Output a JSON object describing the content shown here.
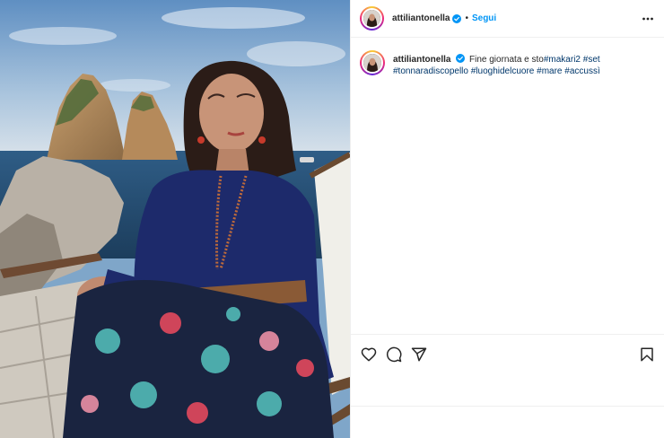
{
  "post": {
    "username": "attiliantonella",
    "follow_label": "Segui",
    "separator": "•",
    "caption": {
      "username": "attiliantonella",
      "text_before": "Fine giornata e sto",
      "hashtags": [
        "#makari2",
        "#set",
        "#tonnaradiscopello",
        "#luoghidelcuore",
        "#mare",
        "#accussì"
      ]
    }
  },
  "icons": {
    "verified": "verified-badge-icon",
    "more": "more-options-icon",
    "like": "heart-icon",
    "comment": "comment-icon",
    "share": "share-icon",
    "save": "bookmark-icon"
  },
  "colors": {
    "accent": "#0095f6",
    "hashtag": "#00376b",
    "text": "#262626",
    "divider": "#efefef"
  }
}
